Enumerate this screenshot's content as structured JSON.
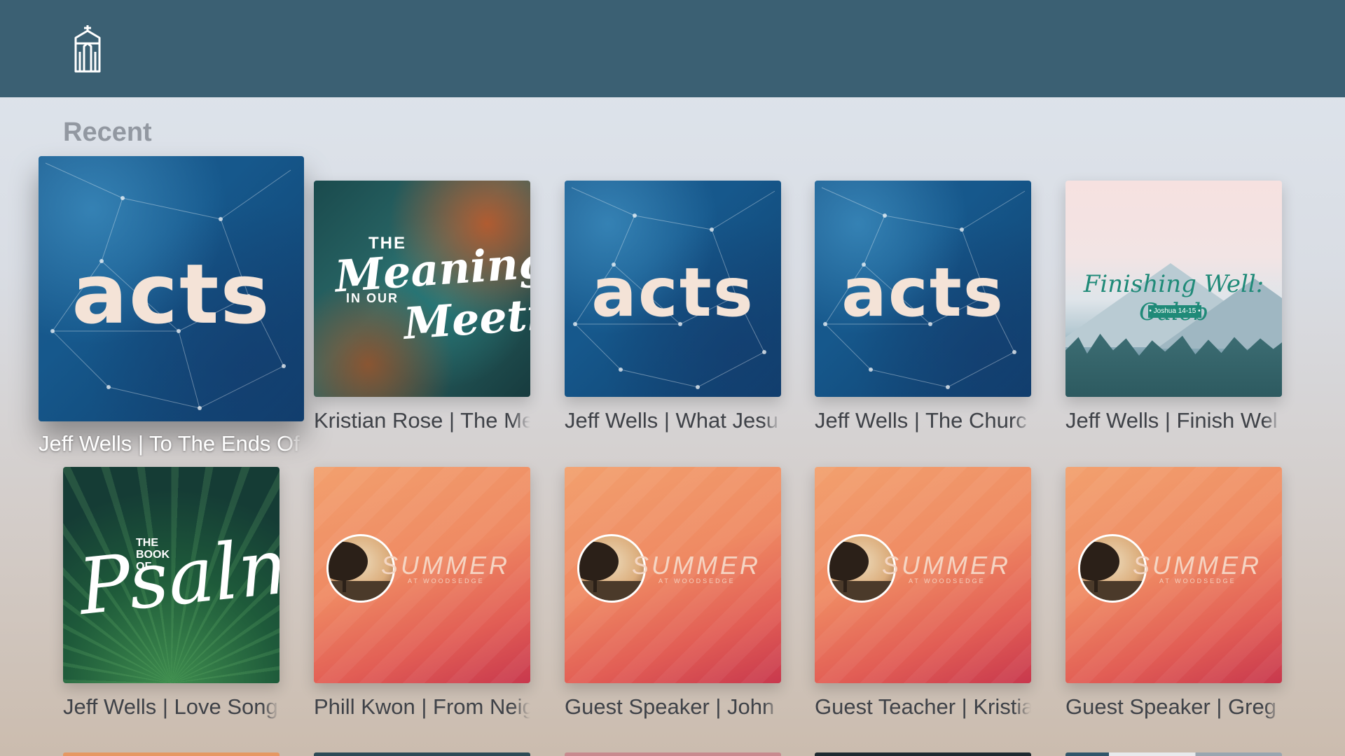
{
  "colors": {
    "topbar": "#3b6073",
    "caption": "#3f4248",
    "focused_caption": "#ffffff",
    "section_title": "#9298a1"
  },
  "header": {
    "logo_icon": "church-logo-icon"
  },
  "recent": {
    "title": "Recent",
    "items": [
      {
        "caption": "Jeff Wells | To The Ends Of",
        "art": "acts",
        "art_text": "acts",
        "focused": true
      },
      {
        "caption": "Kristian Rose | The Me",
        "art": "meaning",
        "art_text": [
          "THE",
          "Meaning",
          "IN OUR",
          "Meeting"
        ]
      },
      {
        "caption": "Jeff Wells | What Jesu",
        "art": "acts",
        "art_text": "acts"
      },
      {
        "caption": "Jeff Wells | The Churc",
        "art": "acts",
        "art_text": "acts"
      },
      {
        "caption": "Jeff Wells | Finish Wel",
        "art": "finishing",
        "art_text": [
          "Finishing Well: Caleb",
          "• Joshua 14-15 •"
        ]
      },
      {
        "caption": "Jeff Wells | Love Song",
        "art": "psalms",
        "art_text": [
          "THE BOOK OF",
          "Psalms"
        ]
      },
      {
        "caption": "Phill Kwon | From Neig",
        "art": "summer",
        "art_text": [
          "SUMMER",
          "AT WOODSEDGE"
        ]
      },
      {
        "caption": "Guest Speaker | John",
        "art": "summer",
        "art_text": [
          "SUMMER",
          "AT WOODSEDGE"
        ]
      },
      {
        "caption": "Guest Teacher | Kristia",
        "art": "summer",
        "art_text": [
          "SUMMER",
          "AT WOODSEDGE"
        ]
      },
      {
        "caption": "Guest Speaker | Greg",
        "art": "summer",
        "art_text": [
          "SUMMER",
          "AT WOODSEDGE"
        ]
      }
    ]
  }
}
